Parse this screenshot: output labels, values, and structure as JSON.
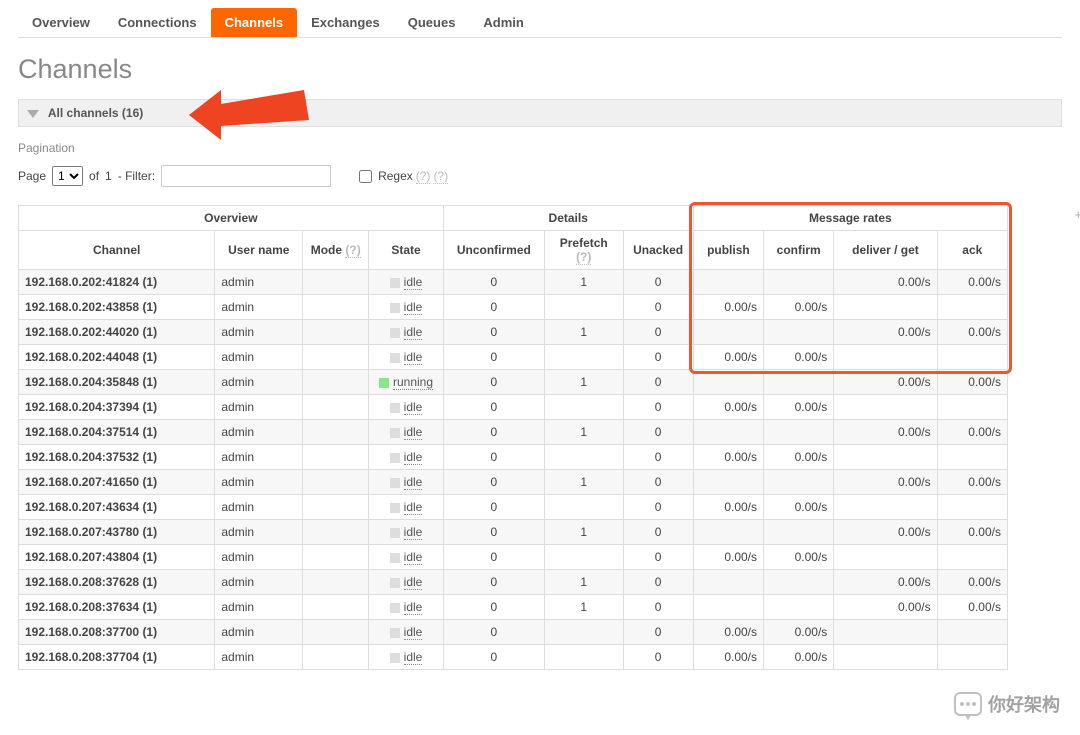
{
  "nav_tabs": [
    "Overview",
    "Connections",
    "Channels",
    "Exchanges",
    "Queues",
    "Admin"
  ],
  "active_tab_index": 2,
  "page_title": "Channels",
  "section_header": "All channels (16)",
  "pagination_label": "Pagination",
  "page_word": "Page",
  "page_select_value": "1",
  "of_word": "of",
  "total_pages": "1",
  "filter_label": "- Filter:",
  "filter_value": "",
  "regex_label": "Regex",
  "regex_checked": false,
  "help_glyph": "(?)",
  "plus_minus": "+/-",
  "table_groups": {
    "overview": "Overview",
    "details": "Details",
    "rates": "Message rates"
  },
  "columns": {
    "channel": "Channel",
    "user": "User name",
    "mode": "Mode",
    "state": "State",
    "unconfirmed": "Unconfirmed",
    "prefetch": "Prefetch",
    "unacked": "Unacked",
    "publish": "publish",
    "confirm": "confirm",
    "deliver": "deliver / get",
    "ack": "ack"
  },
  "rows": [
    {
      "channel": "192.168.0.202:41824 (1)",
      "user": "admin",
      "state": "idle",
      "unconfirmed": "0",
      "prefetch": "1",
      "unacked": "0",
      "publish": "",
      "confirm": "",
      "deliver": "0.00/s",
      "ack": "0.00/s"
    },
    {
      "channel": "192.168.0.202:43858 (1)",
      "user": "admin",
      "state": "idle",
      "unconfirmed": "0",
      "prefetch": "",
      "unacked": "0",
      "publish": "0.00/s",
      "confirm": "0.00/s",
      "deliver": "",
      "ack": ""
    },
    {
      "channel": "192.168.0.202:44020 (1)",
      "user": "admin",
      "state": "idle",
      "unconfirmed": "0",
      "prefetch": "1",
      "unacked": "0",
      "publish": "",
      "confirm": "",
      "deliver": "0.00/s",
      "ack": "0.00/s"
    },
    {
      "channel": "192.168.0.202:44048 (1)",
      "user": "admin",
      "state": "idle",
      "unconfirmed": "0",
      "prefetch": "",
      "unacked": "0",
      "publish": "0.00/s",
      "confirm": "0.00/s",
      "deliver": "",
      "ack": ""
    },
    {
      "channel": "192.168.0.204:35848 (1)",
      "user": "admin",
      "state": "running",
      "unconfirmed": "0",
      "prefetch": "1",
      "unacked": "0",
      "publish": "",
      "confirm": "",
      "deliver": "0.00/s",
      "ack": "0.00/s"
    },
    {
      "channel": "192.168.0.204:37394 (1)",
      "user": "admin",
      "state": "idle",
      "unconfirmed": "0",
      "prefetch": "",
      "unacked": "0",
      "publish": "0.00/s",
      "confirm": "0.00/s",
      "deliver": "",
      "ack": ""
    },
    {
      "channel": "192.168.0.204:37514 (1)",
      "user": "admin",
      "state": "idle",
      "unconfirmed": "0",
      "prefetch": "1",
      "unacked": "0",
      "publish": "",
      "confirm": "",
      "deliver": "0.00/s",
      "ack": "0.00/s"
    },
    {
      "channel": "192.168.0.204:37532 (1)",
      "user": "admin",
      "state": "idle",
      "unconfirmed": "0",
      "prefetch": "",
      "unacked": "0",
      "publish": "0.00/s",
      "confirm": "0.00/s",
      "deliver": "",
      "ack": ""
    },
    {
      "channel": "192.168.0.207:41650 (1)",
      "user": "admin",
      "state": "idle",
      "unconfirmed": "0",
      "prefetch": "1",
      "unacked": "0",
      "publish": "",
      "confirm": "",
      "deliver": "0.00/s",
      "ack": "0.00/s"
    },
    {
      "channel": "192.168.0.207:43634 (1)",
      "user": "admin",
      "state": "idle",
      "unconfirmed": "0",
      "prefetch": "",
      "unacked": "0",
      "publish": "0.00/s",
      "confirm": "0.00/s",
      "deliver": "",
      "ack": ""
    },
    {
      "channel": "192.168.0.207:43780 (1)",
      "user": "admin",
      "state": "idle",
      "unconfirmed": "0",
      "prefetch": "1",
      "unacked": "0",
      "publish": "",
      "confirm": "",
      "deliver": "0.00/s",
      "ack": "0.00/s"
    },
    {
      "channel": "192.168.0.207:43804 (1)",
      "user": "admin",
      "state": "idle",
      "unconfirmed": "0",
      "prefetch": "",
      "unacked": "0",
      "publish": "0.00/s",
      "confirm": "0.00/s",
      "deliver": "",
      "ack": ""
    },
    {
      "channel": "192.168.0.208:37628 (1)",
      "user": "admin",
      "state": "idle",
      "unconfirmed": "0",
      "prefetch": "1",
      "unacked": "0",
      "publish": "",
      "confirm": "",
      "deliver": "0.00/s",
      "ack": "0.00/s"
    },
    {
      "channel": "192.168.0.208:37634 (1)",
      "user": "admin",
      "state": "idle",
      "unconfirmed": "0",
      "prefetch": "1",
      "unacked": "0",
      "publish": "",
      "confirm": "",
      "deliver": "0.00/s",
      "ack": "0.00/s"
    },
    {
      "channel": "192.168.0.208:37700 (1)",
      "user": "admin",
      "state": "idle",
      "unconfirmed": "0",
      "prefetch": "",
      "unacked": "0",
      "publish": "0.00/s",
      "confirm": "0.00/s",
      "deliver": "",
      "ack": ""
    },
    {
      "channel": "192.168.0.208:37704 (1)",
      "user": "admin",
      "state": "idle",
      "unconfirmed": "0",
      "prefetch": "",
      "unacked": "0",
      "publish": "0.00/s",
      "confirm": "0.00/s",
      "deliver": "",
      "ack": ""
    }
  ],
  "watermark": "你好架构"
}
